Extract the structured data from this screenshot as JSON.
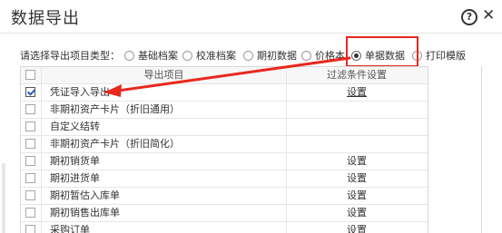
{
  "window": {
    "title": "数据导出",
    "help_icon": "help-circle-icon",
    "help_label": "?",
    "close_icon": "close-icon",
    "close_label": "✕"
  },
  "type_selector": {
    "label": "请选择导出项目类型：",
    "options": [
      {
        "label": "基础档案",
        "selected": false
      },
      {
        "label": "校准档案",
        "selected": false
      },
      {
        "label": "期初数据",
        "selected": false
      },
      {
        "label": "价格本",
        "selected": false
      },
      {
        "label": "单据数据",
        "selected": true
      },
      {
        "label": "打印模版",
        "selected": false
      }
    ]
  },
  "table": {
    "columns": [
      "导出项目",
      "过滤条件设置"
    ],
    "rows": [
      {
        "name": "凭证导入导出",
        "checked": true,
        "setting": "设置"
      },
      {
        "name": "非期初资产卡片（折旧通用）",
        "checked": false,
        "setting": ""
      },
      {
        "name": "自定义结转",
        "checked": false,
        "setting": ""
      },
      {
        "name": "非期初资产卡片（折旧简化）",
        "checked": false,
        "setting": ""
      },
      {
        "name": "期初销货单",
        "checked": false,
        "setting": "设置"
      },
      {
        "name": "期初进货单",
        "checked": false,
        "setting": "设置"
      },
      {
        "name": "期初暂估入库单",
        "checked": false,
        "setting": "设置"
      },
      {
        "name": "期初销售出库单",
        "checked": false,
        "setting": "设置"
      },
      {
        "name": "采购订单",
        "checked": false,
        "setting": "设置"
      }
    ]
  },
  "annotation": {
    "highlight_color": "#e8281f"
  }
}
